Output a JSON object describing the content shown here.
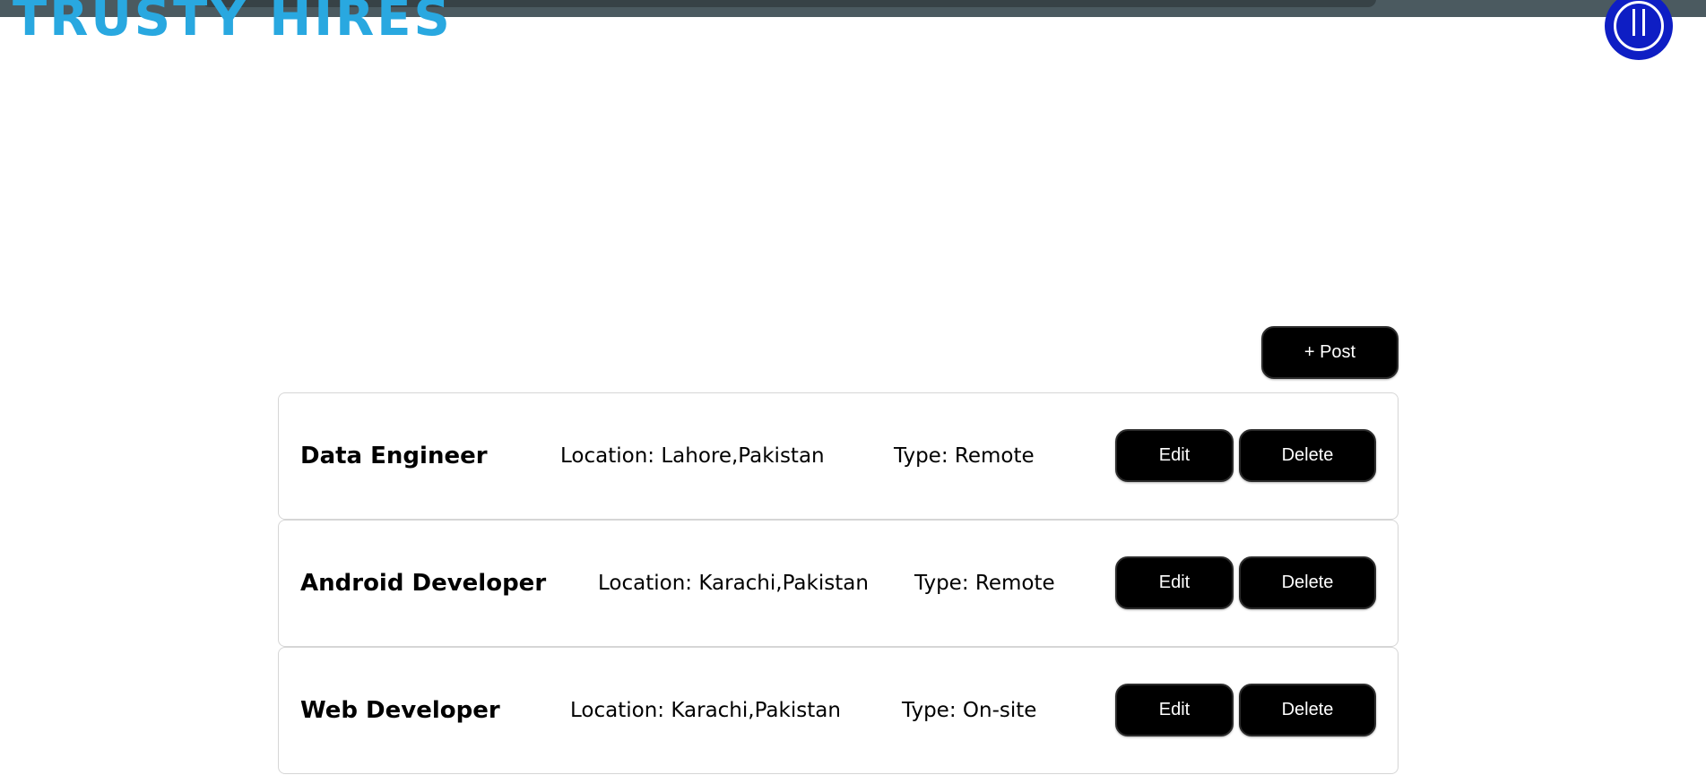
{
  "header": {
    "logo_text": "TRUSTY HIRES",
    "avatar_icon": "power-icon"
  },
  "toolbar": {
    "post_label": "+ Post"
  },
  "jobs": [
    {
      "title": "Data Engineer",
      "location": "Location: Lahore,Pakistan",
      "type": "Type: Remote",
      "edit_label": "Edit",
      "delete_label": "Delete"
    },
    {
      "title": "Android Developer",
      "location": "Location: Karachi,Pakistan",
      "type": "Type: Remote",
      "edit_label": "Edit",
      "delete_label": "Delete"
    },
    {
      "title": "Web Developer",
      "location": "Location: Karachi,Pakistan",
      "type": "Type: On-site",
      "edit_label": "Edit",
      "delete_label": "Delete"
    }
  ],
  "colors": {
    "brand": "#29a8e0",
    "avatar": "#0e1ec4",
    "button": "#000000"
  }
}
